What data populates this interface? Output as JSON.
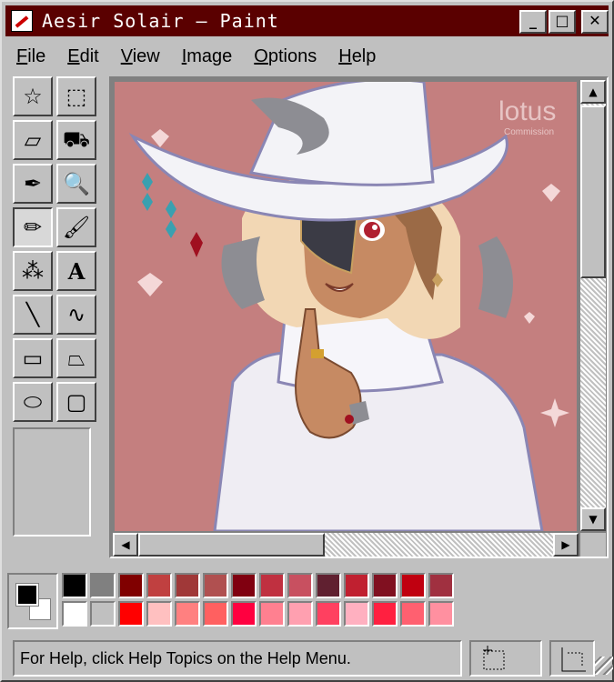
{
  "window": {
    "title": "Aesir Solair – Paint"
  },
  "titlebar_buttons": {
    "minimize": "_",
    "maximize": "□",
    "close": "✕"
  },
  "menu": [
    {
      "label": "File",
      "key": "F"
    },
    {
      "label": "Edit",
      "key": "E"
    },
    {
      "label": "View",
      "key": "V"
    },
    {
      "label": "Image",
      "key": "I"
    },
    {
      "label": "Options",
      "key": "O"
    },
    {
      "label": "Help",
      "key": "H"
    }
  ],
  "tools": [
    {
      "name": "free-select-icon",
      "glyph": "☆"
    },
    {
      "name": "rect-select-icon",
      "glyph": "⬚"
    },
    {
      "name": "eraser-icon",
      "glyph": "▱"
    },
    {
      "name": "fill-bucket-icon",
      "glyph": "⛟"
    },
    {
      "name": "color-picker-icon",
      "glyph": "✒"
    },
    {
      "name": "magnifier-icon",
      "glyph": "🔍"
    },
    {
      "name": "pencil-icon",
      "glyph": "✏"
    },
    {
      "name": "brush-icon",
      "glyph": "🖌"
    },
    {
      "name": "airbrush-icon",
      "glyph": "⁂"
    },
    {
      "name": "text-icon",
      "glyph": "A"
    },
    {
      "name": "line-icon",
      "glyph": "╲"
    },
    {
      "name": "curve-icon",
      "glyph": "∿"
    },
    {
      "name": "rectangle-icon",
      "glyph": "▭"
    },
    {
      "name": "polygon-icon",
      "glyph": "⏢"
    },
    {
      "name": "ellipse-icon",
      "glyph": "⬭"
    },
    {
      "name": "rounded-rect-icon",
      "glyph": "▢"
    }
  ],
  "selected_tool": 6,
  "colors": {
    "foreground": "#000000",
    "background": "#ffffff",
    "canvas_bg": "#c47f7f",
    "titlebar": "#5a0000"
  },
  "palette_top": [
    "#000000",
    "#808080",
    "#800000",
    "#c04040",
    "#a03838",
    "#b05050",
    "#800010",
    "#c03040",
    "#c85060",
    "#602030",
    "#c02030",
    "#801020",
    "#c00010",
    "#a03040"
  ],
  "palette_bottom": [
    "#ffffff",
    "#c0c0c0",
    "#ff0000",
    "#ffc0c0",
    "#ff8080",
    "#ff6060",
    "#ff0040",
    "#ff8090",
    "#ffa0b0",
    "#ff4060",
    "#ffb0c0",
    "#ff2040",
    "#ff6070",
    "#ff90a0"
  ],
  "status": {
    "text": "For Help, click Help Topics on the Help Menu."
  },
  "canvas": {
    "watermark": "lotus",
    "watermark_sub": "Commission"
  }
}
